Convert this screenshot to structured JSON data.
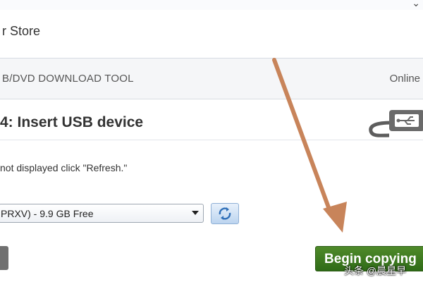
{
  "store": {
    "title": "r Store"
  },
  "tool": {
    "title": "B/DVD DOWNLOAD TOOL",
    "status": "Online"
  },
  "step": {
    "title": "4: Insert USB device"
  },
  "hint": {
    "text": "not displayed click \"Refresh.\""
  },
  "device_select": {
    "value": "PRXV) - 9.9 GB Free"
  },
  "buttons": {
    "begin_copying": "Begin copying"
  },
  "watermark": {
    "text": "头条 @晨星早"
  },
  "colors": {
    "accent_green": "#3b7a1f",
    "annotation_arrow": "#c8845a"
  },
  "icons": {
    "usb": "usb-icon",
    "refresh": "refresh-icon",
    "dropdown": "chevron-down-icon"
  }
}
